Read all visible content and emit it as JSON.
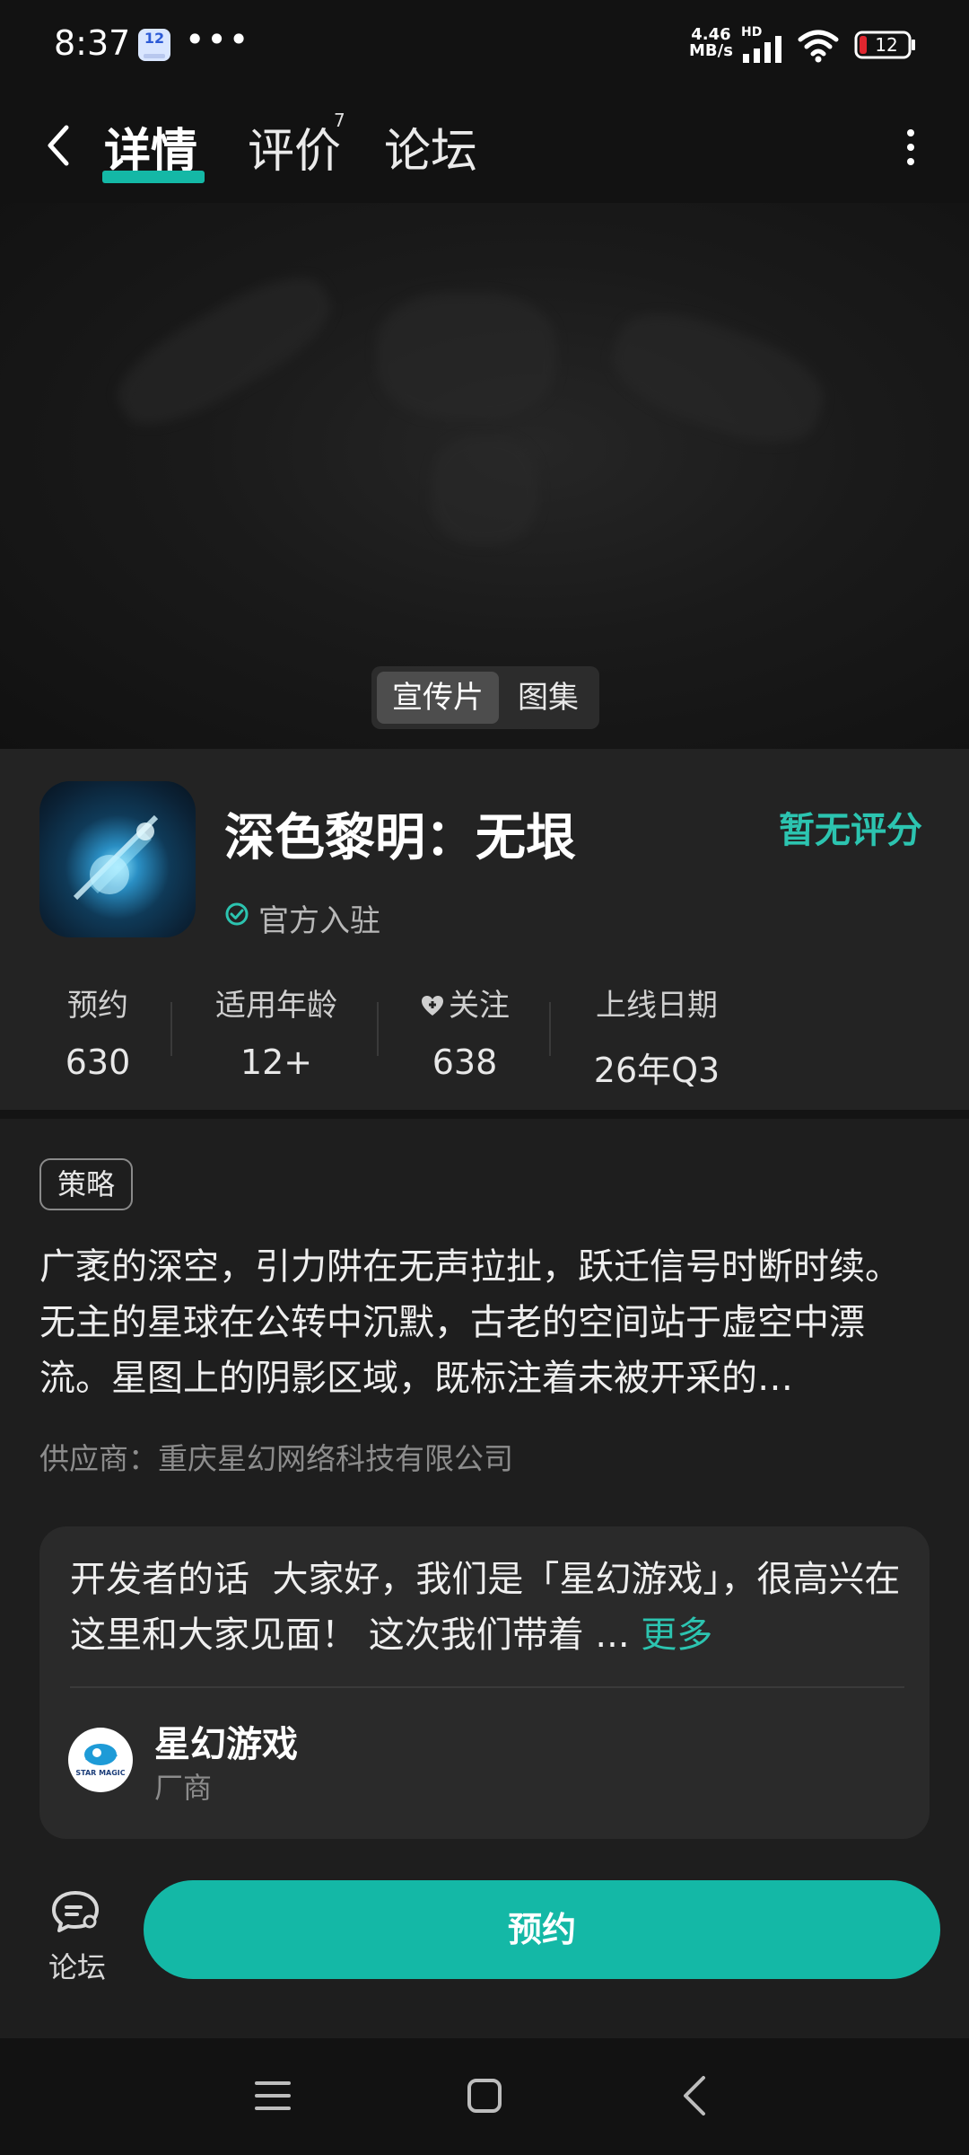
{
  "status_bar": {
    "time": "8:37",
    "app_badge": "12",
    "dots": "•••",
    "net_speed": "4.46",
    "net_unit": "MB/s",
    "hd": "HD",
    "battery": "12",
    "battery_color": "#e0262f"
  },
  "nav": {
    "tabs": [
      {
        "label": "详情"
      },
      {
        "label": "评价",
        "badge": "7"
      },
      {
        "label": "论坛"
      }
    ],
    "accent": "#14b8a6"
  },
  "media": {
    "video_label": "宣传片",
    "gallery_label": "图集"
  },
  "game": {
    "title": "深色黎明：无垠",
    "official_label": "官方入驻",
    "rating_label": "暂无评分",
    "stats": [
      {
        "label": "预约",
        "value": "630"
      },
      {
        "label": "适用年龄",
        "value": "12+"
      },
      {
        "label": "关注",
        "value": "638"
      },
      {
        "label": "上线日期",
        "value": "26年Q3"
      }
    ]
  },
  "description": {
    "tag": "策略",
    "text": "广袤的深空，引力阱在无声拉扯，跃迁信号时断时续。无主的星球在公转中沉默，古老的空间站于虚空中漂流。星图上的阴影区域，既标注着未被开采的…",
    "supplier": "供应商：重庆星幻网络科技有限公司"
  },
  "developer": {
    "label": "开发者的话",
    "text": "大家好，我们是「星幻游戏」，很高兴在这里和大家见面！ 这次我们带着 ...",
    "more": "更多",
    "name": "星幻游戏",
    "role": "厂商",
    "avatar_text": "STAR MAGIC"
  },
  "actions": {
    "forum_label": "论坛",
    "reserve_label": "预约"
  }
}
